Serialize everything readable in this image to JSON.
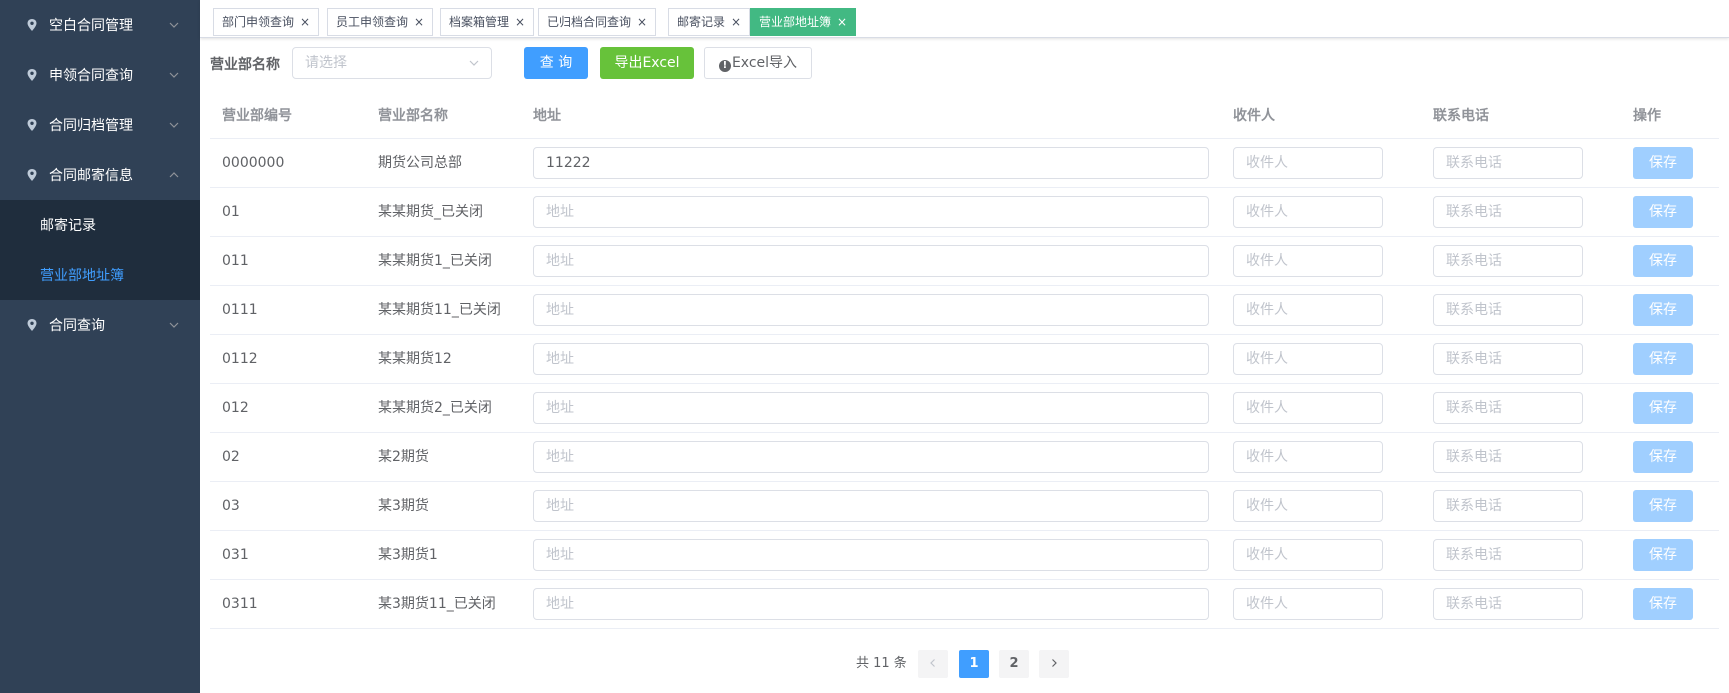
{
  "sidebar": {
    "menus": [
      {
        "label": "空白合同管理",
        "expanded": false
      },
      {
        "label": "申领合同查询",
        "expanded": false
      },
      {
        "label": "合同归档管理",
        "expanded": false
      },
      {
        "label": "合同邮寄信息",
        "expanded": true
      }
    ],
    "submenus": [
      {
        "label": "邮寄记录",
        "active": false
      },
      {
        "label": "营业部地址簿",
        "active": true
      }
    ],
    "last_menu": {
      "label": "合同查询",
      "expanded": false
    }
  },
  "tabs": [
    {
      "label": "部门申领查询",
      "active": false
    },
    {
      "label": "员工申领查询",
      "active": false
    },
    {
      "label": "档案箱管理",
      "active": false
    },
    {
      "label": "已归档合同查询",
      "active": false
    },
    {
      "label": "邮寄记录",
      "active": false
    },
    {
      "label": "营业部地址簿",
      "active": true
    }
  ],
  "filter": {
    "label": "营业部名称",
    "placeholder": "请选择",
    "query_label": "查 询",
    "export_label": "导出Excel",
    "import_label": "Excel导入"
  },
  "table": {
    "headers": {
      "code": "营业部编号",
      "name": "营业部名称",
      "address": "地址",
      "recipient": "收件人",
      "phone": "联系电话",
      "action": "操作"
    },
    "placeholders": {
      "address": "地址",
      "recipient": "收件人",
      "phone": "联系电话"
    },
    "save_label": "保存",
    "rows": [
      {
        "code": "0000000",
        "name": "期货公司总部",
        "address": "11222"
      },
      {
        "code": "01",
        "name": "某某期货_已关闭",
        "address": ""
      },
      {
        "code": "011",
        "name": "某某期货1_已关闭",
        "address": ""
      },
      {
        "code": "0111",
        "name": "某某期货11_已关闭",
        "address": ""
      },
      {
        "code": "0112",
        "name": "某某期货12",
        "address": ""
      },
      {
        "code": "012",
        "name": "某某期货2_已关闭",
        "address": ""
      },
      {
        "code": "02",
        "name": "某2期货",
        "address": ""
      },
      {
        "code": "03",
        "name": "某3期货",
        "address": ""
      },
      {
        "code": "031",
        "name": "某3期货1",
        "address": ""
      },
      {
        "code": "0311",
        "name": "某3期货11_已关闭",
        "address": ""
      }
    ]
  },
  "pagination": {
    "total_text": "共 11 条",
    "pages": [
      "1",
      "2"
    ],
    "current": "1"
  },
  "colors": {
    "sidebar_bg": "#304156",
    "submenu_bg": "#1f2d3d",
    "active_tab": "#42b983",
    "primary": "#409eff",
    "success": "#67c23a",
    "disabled_primary": "#a0cfff"
  }
}
